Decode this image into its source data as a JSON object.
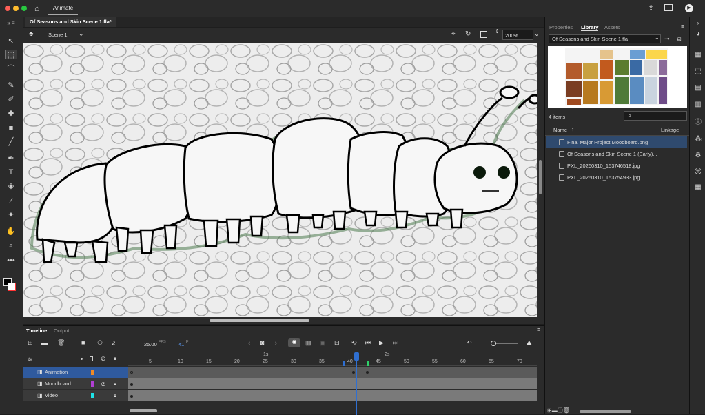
{
  "app": {
    "tab_label": "Animate"
  },
  "document": {
    "tab_title": "Of Seasons and Skin Scene 1.fla*"
  },
  "scene": {
    "label": "Scene 1",
    "zoom": "200%"
  },
  "timeline": {
    "tabs": [
      "Timeline",
      "Output"
    ],
    "fps": "25.00",
    "fps_unit": "FPS",
    "frame": "41",
    "frame_unit": "F",
    "time_markers": [
      "1s",
      "2s"
    ],
    "frame_numbers": [
      "5",
      "10",
      "15",
      "20",
      "25",
      "30",
      "35",
      "40",
      "45",
      "50",
      "55",
      "60",
      "65",
      "70"
    ],
    "current_frame": 41,
    "total_frames_visible": 73,
    "layers": [
      {
        "name": "Animation",
        "color": "#f08a24",
        "selected": true
      },
      {
        "name": "Moodboard",
        "color": "#b23fd4",
        "selected": false
      },
      {
        "name": "Video",
        "color": "#1ee3e8",
        "selected": false
      }
    ]
  },
  "panel": {
    "tabs": [
      "Properties",
      "Library",
      "Assets"
    ],
    "active_tab": "Library",
    "library_doc": "Of Seasons and Skin Scene 1.fla",
    "item_count": "4 items",
    "col_name": "Name",
    "col_linkage": "Linkage",
    "items": [
      {
        "name": "Final Major Project Moodboard.png",
        "type": "bitmap",
        "selected": true
      },
      {
        "name": "Of Seasons and Skin Scene 1 (Early)...",
        "type": "video",
        "selected": false
      },
      {
        "name": "PXL_20260310_153746518.jpg",
        "type": "bitmap",
        "selected": false
      },
      {
        "name": "PXL_20260310_153754933.jpg",
        "type": "bitmap",
        "selected": false
      }
    ]
  },
  "colors": {
    "accent": "#2f6fd1",
    "stroke": "#000000",
    "fill": "#ffffff"
  }
}
